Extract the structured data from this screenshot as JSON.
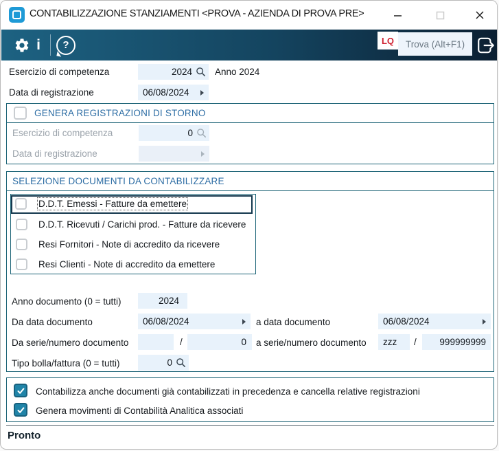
{
  "window": {
    "title": "CONTABILIZZAZIONE STANZIAMENTI <PROVA - AZIENDA DI PROVA PRE>",
    "controls": {
      "minimize": "minimize-icon",
      "maximize": "maximize-icon",
      "close": "close-icon"
    }
  },
  "toolbar": {
    "gear_icon": "settings-gear-icon",
    "info_glyph": "i",
    "help_glyph": "?",
    "lq_badge": "LQ",
    "search_placeholder": "Trova (Alt+F1)",
    "exit_icon": "exit-arrow-icon"
  },
  "main": {
    "esercizio": {
      "label": "Esercizio di competenza",
      "value": "2024",
      "year_note": "Anno 2024"
    },
    "data_registrazione": {
      "label": "Data di registrazione",
      "value": "06/08/2024"
    }
  },
  "storno": {
    "title": "GENERA REGISTRAZIONI DI STORNO",
    "checked": false,
    "esercizio": {
      "label": "Esercizio di competenza",
      "value": "0"
    },
    "data_registrazione": {
      "label": "Data di registrazione",
      "value": ""
    }
  },
  "selezione": {
    "title": "SELEZIONE DOCUMENTI DA CONTABILIZZARE",
    "items": [
      {
        "label": "D.D.T. Emessi - Fatture da emettere",
        "checked": false,
        "focused": true
      },
      {
        "label": "D.D.T. Ricevuti / Carichi prod. - Fatture da ricevere",
        "checked": false,
        "focused": false
      },
      {
        "label": "Resi Fornitori - Note di accredito da ricevere",
        "checked": false,
        "focused": false
      },
      {
        "label": "Resi Clienti - Note di accredito da emettere",
        "checked": false,
        "focused": false
      }
    ],
    "anno_documento": {
      "label": "Anno documento (0 = tutti)",
      "value": "2024"
    },
    "da_data": {
      "label": "Da data documento",
      "value": "06/08/2024"
    },
    "a_data": {
      "label": "a data documento",
      "value": "06/08/2024"
    },
    "da_serie": {
      "label": "Da serie/numero documento",
      "serie": "",
      "separator": "/",
      "numero": "0"
    },
    "a_serie": {
      "label": "a serie/numero documento",
      "serie": "zzz",
      "separator": "/",
      "numero": "999999999"
    },
    "tipo_bolla": {
      "label": "Tipo bolla/fattura (0 = tutti)",
      "value": "0"
    }
  },
  "options": {
    "items": [
      {
        "label": "Contabilizza anche documenti già contabilizzati in precedenza e cancella relative registrazioni",
        "checked": true
      },
      {
        "label": "Genera movimenti di Contabilità Analitica associati",
        "checked": true
      }
    ]
  },
  "statusbar": {
    "text": "Pronto"
  },
  "colors": {
    "toolbar_left": "#1d6282",
    "toolbar_right": "#0b1f32",
    "accent_teal": "#1a6275",
    "header_blue": "#2d6da4",
    "field_bg": "#e8f2fb",
    "checkbox_checked": "#2084a8",
    "lq_red": "#cf2030",
    "logo_blue": "#1e9ad6"
  }
}
